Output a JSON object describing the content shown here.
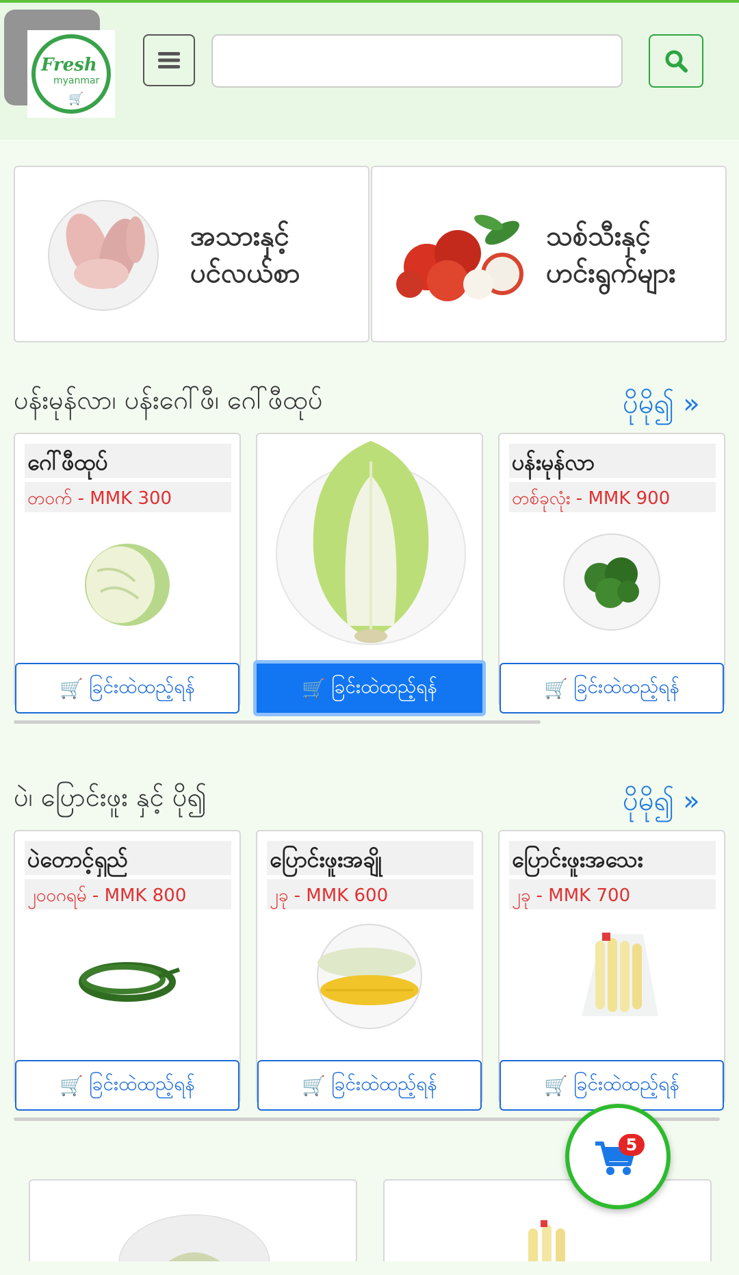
{
  "header": {
    "logo_text_main": "Fresh",
    "logo_text_sub": "myanmar",
    "search_placeholder": ""
  },
  "categories": [
    {
      "label_line1": "အသားနှင့်",
      "label_line2": "ပင်လယ်စာ",
      "image": "raw-chicken-on-plate"
    },
    {
      "label_line1": "သစ်သီးနှင့်",
      "label_line2": "ဟင်းရွက်များ",
      "image": "rambutan-fruit"
    }
  ],
  "sections": [
    {
      "title": "ပန်းမုန်လာ၊ ပန်းဂေါ်ဖီ၊ ဂေါ်ဖီထုပ်",
      "more": "ပိုမို၍ »",
      "products": [
        {
          "name": "ဂေါ်ဖီထုပ်",
          "price": "တဝက် - MMK 300",
          "button": "ခြင်းထဲထည့်ရန်",
          "image": "cabbage-half"
        },
        {
          "name": "",
          "price": "",
          "button": "ခြင်းထဲထည့်ရန်",
          "image": "chinese-cabbage"
        },
        {
          "name": "ပန်းမုန်လာ",
          "price": "တစ်ခုလုံး - MMK 900",
          "button": "ခြင်းထဲထည့်ရန်",
          "image": "broccoli"
        }
      ]
    },
    {
      "title": "ပဲ၊ ပြောင်းဖူး နှင့် ပို၍",
      "more": "ပိုမို၍ »",
      "products": [
        {
          "name": "ပဲတောင့်ရှည်",
          "price": "၂၀၀ဂရမ် - MMK 800",
          "button": "ခြင်းထဲထည့်ရန်",
          "image": "long-beans"
        },
        {
          "name": "ပြောင်းဖူးအချို",
          "price": "၂ခု - MMK 600",
          "button": "ခြင်းထဲထည့်ရန်",
          "image": "sweet-corn"
        },
        {
          "name": "ပြောင်းဖူးအသေး",
          "price": "၂ခု - MMK 700",
          "button": "ခြင်းထဲထည့်ရန်",
          "image": "baby-corn"
        }
      ]
    }
  ],
  "cart": {
    "count": "5",
    "icon": "cart-icon"
  },
  "colors": {
    "accent_green": "#2ea442",
    "button_blue": "#1a6bd8",
    "price_red": "#e03030",
    "link_blue": "#1f7ae0"
  }
}
